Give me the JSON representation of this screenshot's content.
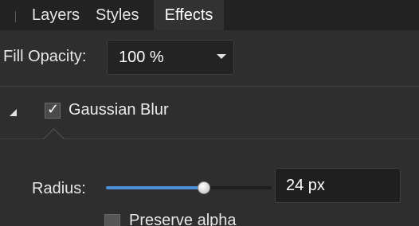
{
  "tabs": [
    {
      "label": "Layers",
      "active": false
    },
    {
      "label": "Styles",
      "active": false
    },
    {
      "label": "Effects",
      "active": true
    }
  ],
  "fill_opacity": {
    "label": "Fill Opacity:",
    "value": "100 %"
  },
  "effect": {
    "name": "Gaussian Blur",
    "enabled": true,
    "expanded": true,
    "radius": {
      "label": "Radius:",
      "value_text": "24 px",
      "slider_fraction": 0.59
    },
    "preserve_alpha": {
      "label": "Preserve alpha",
      "checked": false
    }
  },
  "colors": {
    "accent": "#4a8fd8",
    "panel_bg": "#2e2e2e",
    "tabbar_bg": "#222222"
  },
  "icons": {
    "collapse": "collapse-triangle-icon",
    "dropdown": "chevron-down-icon",
    "check": "checkmark-icon"
  }
}
